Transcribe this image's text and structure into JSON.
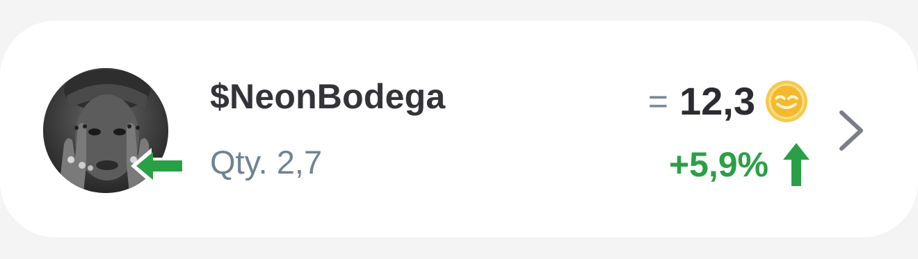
{
  "asset": {
    "avatar_icon": "user-avatar-photo",
    "ticker": "$NeonBodega",
    "quantity_label": "Qty. 2,7"
  },
  "transfer_badge": {
    "icon": "arrow-left-icon",
    "color": "#2aa046"
  },
  "price": {
    "approx_symbol": "=",
    "value": "12,3",
    "currency_icon": "coin-icon",
    "currency_color": "#f5b82e"
  },
  "change": {
    "value": "+5,9%",
    "direction_icon": "arrow-up-icon",
    "color": "#2aa046"
  },
  "navigation": {
    "icon": "chevron-right-icon"
  }
}
